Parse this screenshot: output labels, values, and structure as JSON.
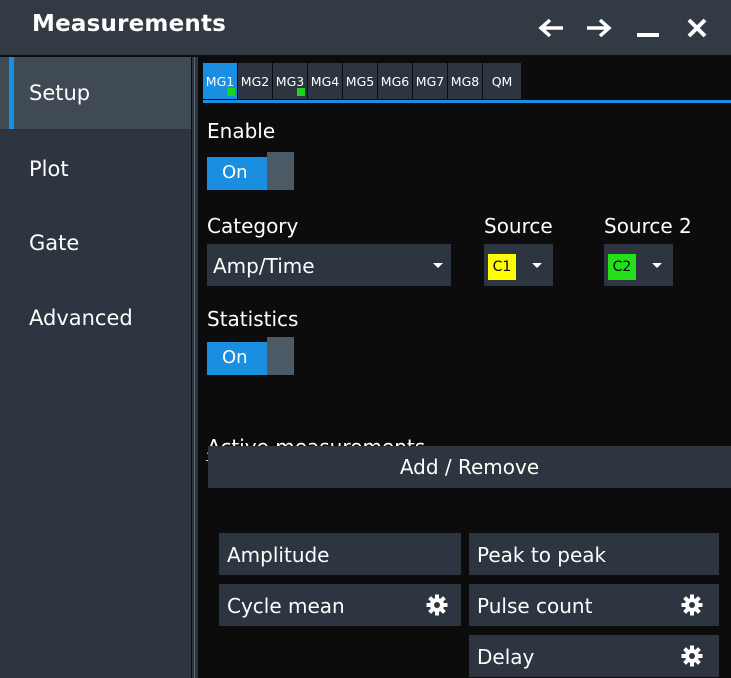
{
  "window": {
    "title": "Measurements"
  },
  "sidebar": {
    "items": [
      {
        "label": "Setup",
        "active": true
      },
      {
        "label": "Plot",
        "active": false
      },
      {
        "label": "Gate",
        "active": false
      },
      {
        "label": "Advanced",
        "active": false
      }
    ]
  },
  "tabs": [
    {
      "label": "MG1",
      "active": true,
      "indicator": true
    },
    {
      "label": "MG2",
      "active": false,
      "indicator": false
    },
    {
      "label": "MG3",
      "active": false,
      "indicator": true
    },
    {
      "label": "MG4",
      "active": false,
      "indicator": false
    },
    {
      "label": "MG5",
      "active": false,
      "indicator": false
    },
    {
      "label": "MG6",
      "active": false,
      "indicator": false
    },
    {
      "label": "MG7",
      "active": false,
      "indicator": false
    },
    {
      "label": "MG8",
      "active": false,
      "indicator": false
    },
    {
      "label": "QM",
      "active": false,
      "indicator": false
    }
  ],
  "setup": {
    "enable_label": "Enable",
    "enable_value": "On",
    "category_label": "Category",
    "category_value": "Amp/Time",
    "source_label": "Source",
    "source_value": "C1",
    "source2_label": "Source 2",
    "source2_value": "C2",
    "statistics_label": "Statistics",
    "statistics_value": "On",
    "active_label": "Active measurements",
    "add_remove_label": "Add / Remove"
  },
  "measurements": [
    {
      "label": "Amplitude",
      "settings": false
    },
    {
      "label": "Peak to peak",
      "settings": false
    },
    {
      "label": "Cycle mean",
      "settings": true
    },
    {
      "label": "Pulse count",
      "settings": true
    },
    {
      "label": "Delay",
      "settings": true
    }
  ],
  "colors": {
    "accent": "#1a8ee0",
    "panel": "#2d3640",
    "source_c1": "#ffff00",
    "source_c2": "#22e01a",
    "indicator": "#1cd41c"
  },
  "icons": {
    "back": "arrow-left-icon",
    "forward": "arrow-right-icon",
    "minimize": "minimize-icon",
    "close": "close-icon",
    "dropdown": "chevron-down-icon",
    "settings": "gear-icon"
  }
}
